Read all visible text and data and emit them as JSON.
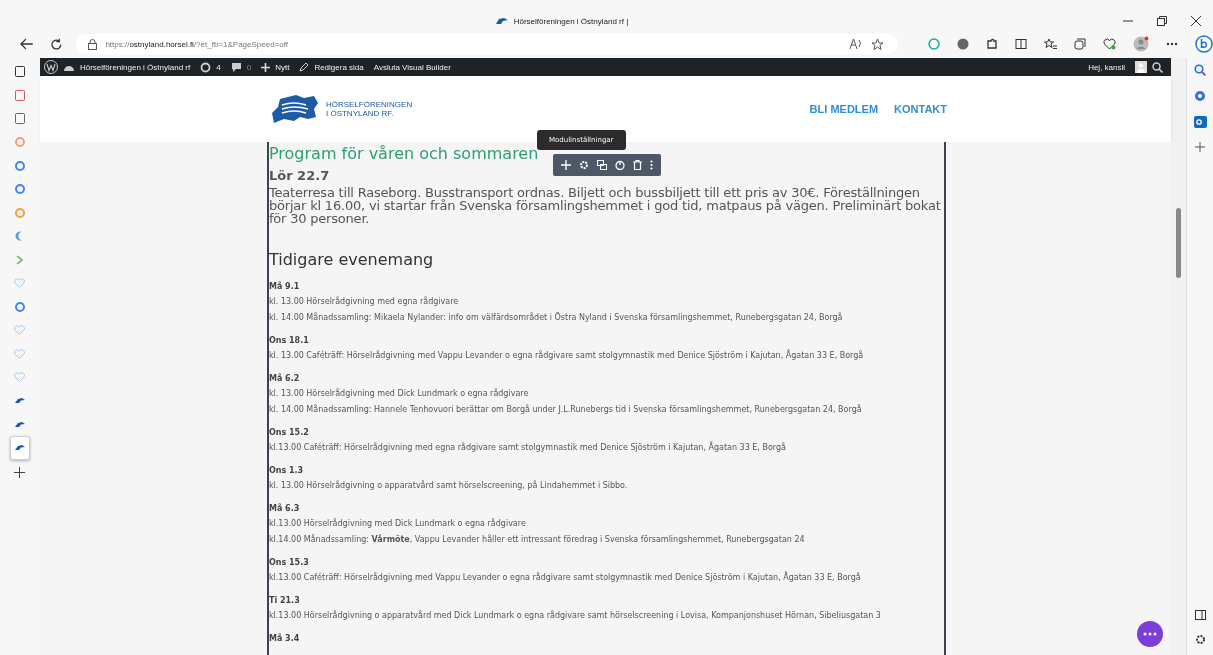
{
  "browser": {
    "tab_title": "Hörselföreningen i Östnyland rf |",
    "url_scheme": "https://",
    "url_host": "ostnyland.horsel.fi",
    "url_path": "/?et_fb=1&PageSpeed=off"
  },
  "sidebar_tabs": [
    {
      "kind": "tabs",
      "selected": false
    },
    {
      "kind": "pdf",
      "selected": false
    },
    {
      "kind": "page",
      "selected": false
    },
    {
      "kind": "k",
      "selected": false
    },
    {
      "kind": "g",
      "selected": false
    },
    {
      "kind": "g",
      "selected": false
    },
    {
      "kind": "h",
      "selected": false
    },
    {
      "kind": "moon",
      "selected": false
    },
    {
      "kind": "chevron",
      "selected": false
    },
    {
      "kind": "heart",
      "selected": false
    },
    {
      "kind": "g",
      "selected": false
    },
    {
      "kind": "heart",
      "selected": false
    },
    {
      "kind": "heart",
      "selected": false
    },
    {
      "kind": "heart",
      "selected": false
    },
    {
      "kind": "bird",
      "selected": false
    },
    {
      "kind": "bird",
      "selected": false
    },
    {
      "kind": "bird",
      "selected": true
    }
  ],
  "admin_bar": {
    "site": "Hörselföreningen i Östnyland rf",
    "updates": "4",
    "comments": "0",
    "new": "Nytt",
    "edit": "Redigera sida",
    "exit": "Avsluta Visual Builder",
    "greeting": "Hej, kansli"
  },
  "site_header": {
    "logo_line1": "HÖRSELFÖRENINGEN",
    "logo_line2": "I ÖSTNYLAND RF.",
    "nav": [
      "BLI MEDLEM",
      "KONTAKT"
    ]
  },
  "content": {
    "heading": "Program för våren och sommaren",
    "tooltip": "Modulinställningar",
    "event_title": "Lör 22.7",
    "event_text": "Teaterresa till Raseborg. Busstransport ordnas. Biljett och bussbiljett till ett pris av 30€. Föreställningen börjar kl 16.00, vi startar från Svenska församlingshemmet i god tid, matpaus på vägen. Preliminärt bokat för 30 personer.",
    "past_heading": "Tidigare evenemang",
    "past_events": [
      {
        "day": "Må 9.1",
        "lines": [
          "kl. 13.00 Hörselrådgivning med egna rådgivare",
          "kl. 14.00 Månadssamling: Mikaela Nylander: info om välfärdsområdet i Östra Nyland i Svenska församlingshemmet, Runebergsgatan 24, Borgå"
        ]
      },
      {
        "day": "Ons 18.1",
        "lines": [
          "kl. 13.00 Caféträff: Hörselrådgivning med Vappu Levander o egna rådgivare samt stolgymnastik med Denice Sjöström i Kajutan, Ågatan 33 E, Borgå"
        ]
      },
      {
        "day": "Må 6.2",
        "lines": [
          "kl. 13.00 Hörselrådgivning med Dick Lundmark o egna rådgivare",
          "kl. 14.00 Månadssamling: Hannele Tenhovuori berättar om Borgå under J.L.Runebergs tid i Svenska församlingshemmet, Runebergsgatan 24, Borgå"
        ]
      },
      {
        "day": "Ons 15.2",
        "lines": [
          "kl.13.00 Caféträff: Hörselrådgivning med egna rådgivare samt stolgymnastik med Denice Sjöström i Kajutan, Ågatan 33 E, Borgå"
        ]
      },
      {
        "day": "Ons 1.3",
        "lines": [
          "kl. 13.00 Hörselrådgivning o apparatvård samt hörselscreening, på Lindahemmet i Sibbo."
        ]
      },
      {
        "day": "Må 6.3",
        "lines": [
          "kl.13.00 Hörselrådgivning med Dick Lundmark o egna rådgivare",
          "kl.14.00 Månadssamling: **Vårmöte**, Vappu Levander håller ett intressant föredrag i Svenska församlingshemmet, Runebergsgatan 24"
        ]
      },
      {
        "day": "Ons 15.3",
        "lines": [
          "kl.13.00 Caféträff: Hörselrådgivning med Vappu Levander o egna rådgivare samt stolgymnastik med Denice Sjöström i Kajutan, Ågatan 33 E, Borgå"
        ]
      },
      {
        "day": "Ti 21.3",
        "lines": [
          "kl.13.00 Hörselrådgivning o apparatvård med Dick Lundmark o egna rådgivare samt hörselscreening i Lovisa, Kompanjonshuset Hörnan, Sibeliusgatan 3"
        ]
      },
      {
        "day": "Må 3.4"
      }
    ]
  }
}
